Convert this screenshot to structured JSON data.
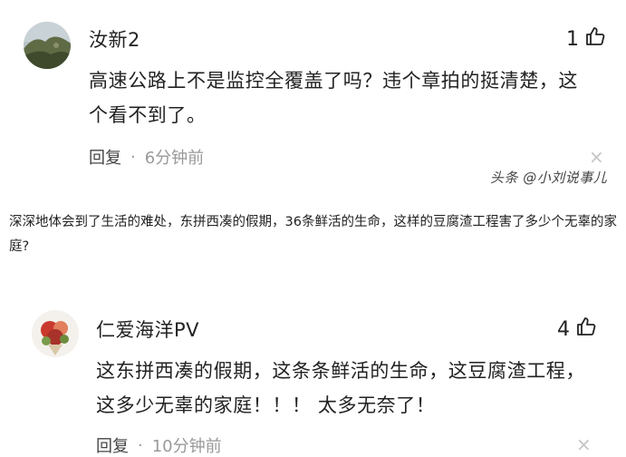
{
  "comment1": {
    "username": "汝新2",
    "likes": "1",
    "text_line1": "高速公路上不是监控全覆盖了吗？违个章拍的挺清楚，这",
    "text_line2": "个看不到了。",
    "reply_label": "回复",
    "separator": "·",
    "time": "6分钟前",
    "close_glyph": "×"
  },
  "watermark": "头条 @小刘说事儿",
  "article": {
    "text": "深深地体会到了生活的难处，东拼西凑的假期，36条鲜活的生命，这样的豆腐渣工程害了多少个无辜的家庭?"
  },
  "comment2": {
    "username": "仁爱海洋PV",
    "likes": "4",
    "text_line1": "这东拼西凑的假期，这条条鲜活的生命，这豆腐渣工程，",
    "text_line2": "这多少无辜的家庭！！！ 太多无奈了！",
    "reply_label": "回复",
    "separator": "·",
    "time": "10分钟前",
    "close_glyph": "×"
  },
  "icons": {
    "like": "thumbs-up-icon",
    "close": "close-icon"
  },
  "colors": {
    "text": "#222222",
    "muted": "#999999",
    "close": "#c4c4c4"
  }
}
